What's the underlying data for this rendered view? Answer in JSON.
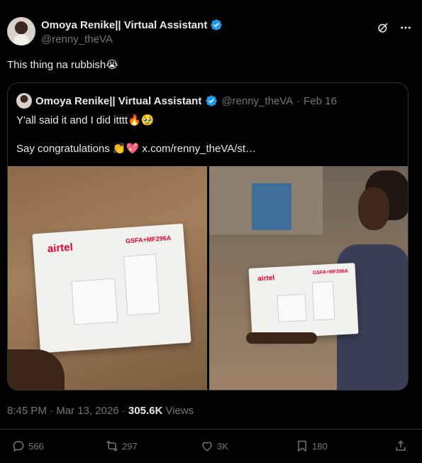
{
  "author": {
    "name": "Omoya Renike|| Virtual Assistant",
    "handle": "@renny_theVA"
  },
  "tweet": {
    "text": "This thing na rubbish😭"
  },
  "quoted": {
    "name": "Omoya Renike|| Virtual Assistant",
    "handle": "@renny_theVA",
    "separator": "·",
    "date": "Feb 16",
    "line1": "Y'all said it and I did itttt🔥🥹",
    "line2": "Say congratulations 👏💖 x.com/renny_theVA/st…",
    "photos": {
      "box_brand": "airtel",
      "box_model": "GSFA+MF296A"
    }
  },
  "meta": {
    "time": "8:45 PM · Mar 13, 2026 · ",
    "views_count": "305.6K",
    "views_label": " Views"
  },
  "actions": {
    "replies": "566",
    "reposts": "297",
    "likes": "3K",
    "bookmarks": "180"
  },
  "colors": {
    "background": "#000000",
    "text": "#e7e9ea",
    "muted": "#71767b",
    "border": "#2f3336",
    "verified": "#1d9bf0",
    "brand": "#e4002b"
  },
  "icons": {
    "verified": "verified-badge-icon",
    "grok": "grok-icon",
    "more": "more-icon",
    "reply": "reply-icon",
    "repost": "repost-icon",
    "like": "like-icon",
    "bookmark": "bookmark-icon",
    "share": "share-icon"
  }
}
